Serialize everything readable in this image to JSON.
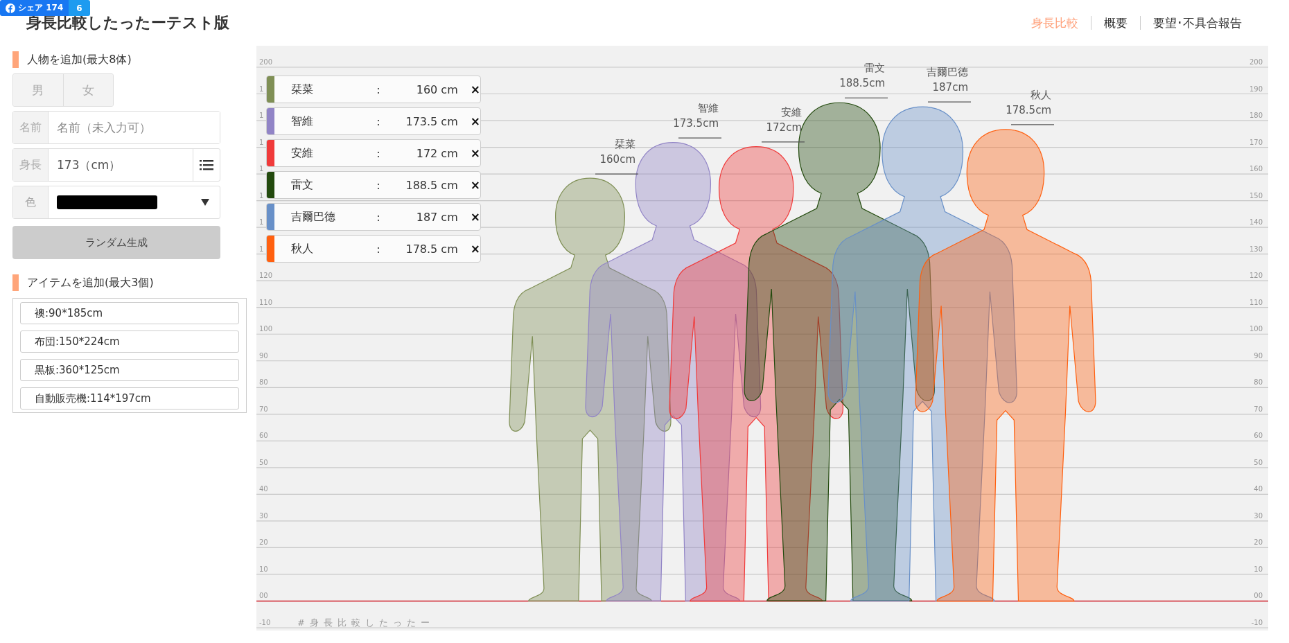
{
  "share_button": {
    "label": "シェア 174",
    "count": "6"
  },
  "title": "身長比較したったーテスト版",
  "nav": [
    {
      "label": "身長比較",
      "selected": true
    },
    {
      "label": "概要",
      "selected": false
    },
    {
      "label": "要望･不具合報告",
      "selected": false
    }
  ],
  "add_person": {
    "heading": "人物を追加(最大8体)",
    "gender_buttons": [
      {
        "label": "男",
        "selected": false
      },
      {
        "label": "女",
        "selected": false
      }
    ],
    "name_field": {
      "label": "名前",
      "placeholder": "名前（未入力可）"
    },
    "height_field": {
      "label": "身長",
      "value": "173（cm）"
    },
    "color_field": {
      "label": "色",
      "color": "#000000"
    },
    "random_button": "ランダム生成"
  },
  "add_item": {
    "heading": "アイテムを追加(最大3個)",
    "items": [
      "襖:90*185cm",
      "布団:150*224cm",
      "黒板:360*125cm",
      "自動販売機:114*197cm"
    ]
  },
  "legend": [
    {
      "name": "栞菜",
      "separator": ":",
      "height": "160 cm",
      "remove": "×",
      "color": "#7f8f55"
    },
    {
      "name": "智維",
      "separator": ":",
      "height": "173.5 cm",
      "remove": "×",
      "color": "#9184c6"
    },
    {
      "name": "安維",
      "separator": ":",
      "height": "172 cm",
      "remove": "×",
      "color": "#f03a3a"
    },
    {
      "name": "雷文",
      "separator": ":",
      "height": "188.5 cm",
      "remove": "×",
      "color": "#234a0e"
    },
    {
      "name": "吉爾巴德",
      "separator": ":",
      "height": "187 cm",
      "remove": "×",
      "color": "#6890c8"
    },
    {
      "name": "秋人",
      "separator": ":",
      "height": "178.5 cm",
      "remove": "×",
      "color": "#ff6010"
    }
  ],
  "chart": {
    "left_ticks": [
      "200",
      "1",
      "1",
      "1",
      "1",
      "1",
      "1",
      "1",
      "120",
      "110",
      "100",
      "90",
      "80",
      "70",
      "60",
      "50",
      "40",
      "30",
      "20",
      "10",
      "00",
      "-10"
    ],
    "right_ticks": [
      "200",
      "190",
      "180",
      "170",
      "160",
      "150",
      "140",
      "130",
      "120",
      "110",
      "100",
      "90",
      "80",
      "70",
      "60",
      "50",
      "40",
      "30",
      "20",
      "10",
      "00",
      "-10"
    ],
    "figures": [
      {
        "name": "栞菜",
        "height": "160cm"
      },
      {
        "name": "智維",
        "height": "173.5cm"
      },
      {
        "name": "安維",
        "height": "172cm"
      },
      {
        "name": "雷文",
        "height": "188.5cm"
      },
      {
        "name": "吉爾巴德",
        "height": "187cm"
      },
      {
        "name": "秋人",
        "height": "178.5cm"
      }
    ],
    "hashtag": "#身長比較したったー"
  }
}
